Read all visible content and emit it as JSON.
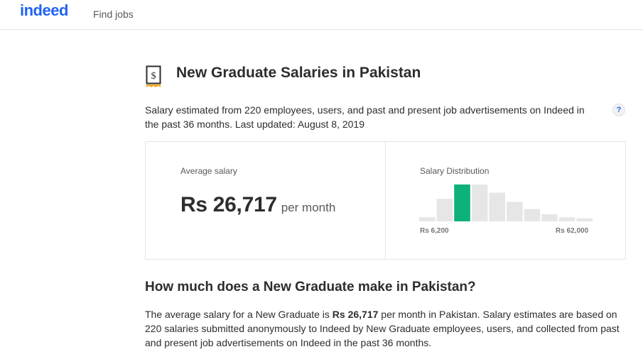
{
  "header": {
    "logo_text": "indeed",
    "nav_find_jobs": "Find jobs",
    "brand_color": "#2164f3"
  },
  "page": {
    "title": "New Graduate Salaries in Pakistan",
    "title_icon": "receipt-dollar-icon",
    "subtitle": "Salary estimated from 220 employees, users, and past and present job advertisements on Indeed in the past 36 months. Last updated: August 8, 2019",
    "help_icon": "question-mark-icon",
    "help_label": "?"
  },
  "salary_card": {
    "average_label": "Average salary",
    "average_amount": "Rs 26,717",
    "average_unit": "per month",
    "distribution_label": "Salary Distribution",
    "distribution_min": "Rs 6,200",
    "distribution_max": "Rs 62,000",
    "highlight_color": "#0eb17c",
    "bar_color": "#e6e6e6"
  },
  "chart_data": {
    "type": "bar",
    "title": "Salary Distribution",
    "values": [
      4,
      22,
      36,
      36,
      28,
      19,
      12,
      7,
      4,
      3
    ],
    "highlighted_index": 2,
    "x_range": [
      "Rs 6,200",
      "Rs 62,000"
    ]
  },
  "section": {
    "heading": "How much does a New Graduate make in Pakistan?",
    "body_prefix": "The average salary for a New Graduate is ",
    "body_amount": "Rs 26,717",
    "body_suffix": " per month in Pakistan. Salary estimates are based on 220 salaries submitted anonymously to Indeed by New Graduate employees, users, and collected from past and present job advertisements on Indeed in the past 36 months."
  }
}
